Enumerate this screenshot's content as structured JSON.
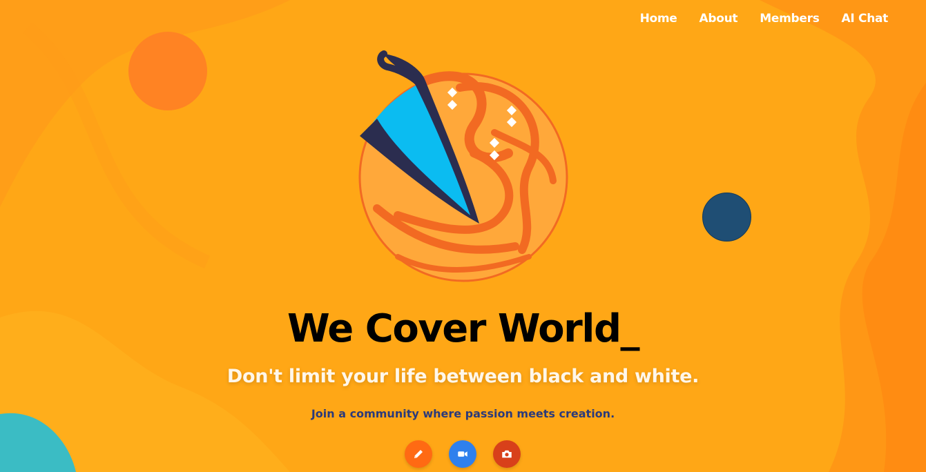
{
  "nav": {
    "items": [
      {
        "label": "Home"
      },
      {
        "label": "About"
      },
      {
        "label": "Members"
      },
      {
        "label": "AI Chat"
      }
    ]
  },
  "hero": {
    "title": "We Cover World_",
    "subtitle": "Don't limit your life between black and white.",
    "tagline": "Join a community where passion meets creation."
  },
  "actions": [
    {
      "icon": "pencil-icon",
      "color": "#ff6a13"
    },
    {
      "icon": "video-camera-icon",
      "color": "#2f80ed"
    },
    {
      "icon": "camera-icon",
      "color": "#d8401a"
    }
  ],
  "colors": {
    "background": "#ffa716",
    "accent_orange": "#ff8323",
    "accent_blue": "#1f4e74",
    "teal": "#3bbcc4",
    "tagline": "#2b3a7a"
  }
}
